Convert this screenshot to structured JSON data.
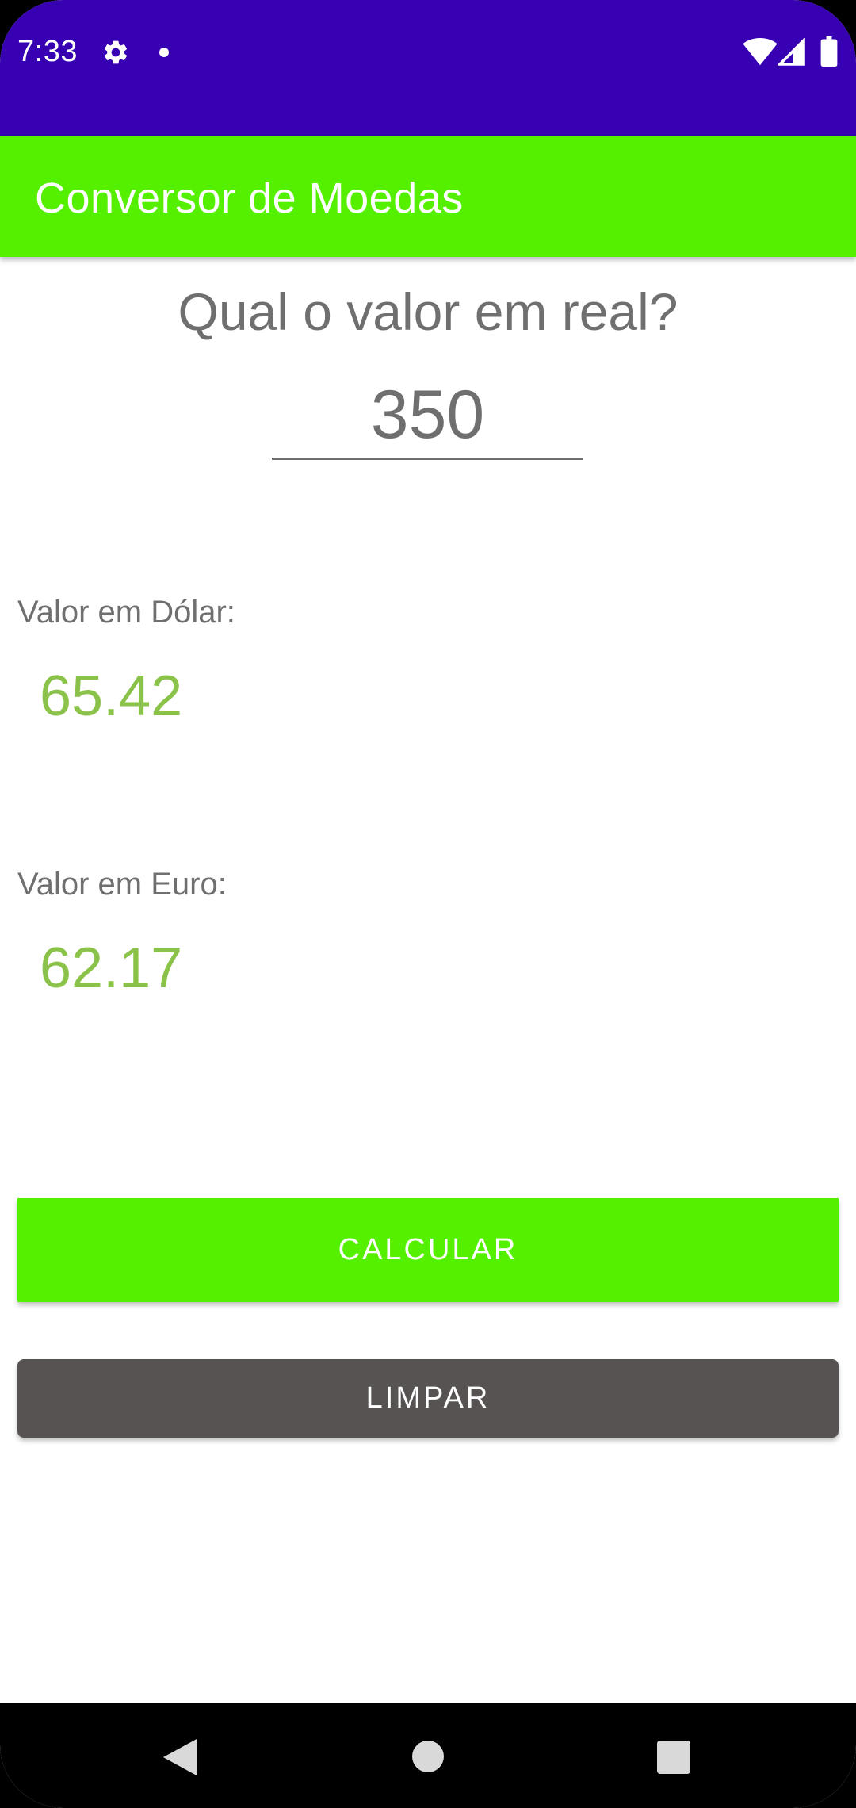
{
  "status_bar": {
    "time": "7:33",
    "icons": [
      "gear-icon",
      "notification-dot-icon",
      "wifi-icon",
      "signal-icon",
      "battery-icon"
    ],
    "background": "#3700b3"
  },
  "app_bar": {
    "title": "Conversor de Moedas",
    "background": "#55f000"
  },
  "main": {
    "question": "Qual o valor em real?",
    "input_value": "350",
    "dollar_label": "Valor em Dólar:",
    "dollar_value": "65.42",
    "euro_label": "Valor em Euro:",
    "euro_value": "62.17",
    "result_color": "#8bc34a"
  },
  "buttons": {
    "calculate_label": "CALCULAR",
    "clear_label": "LIMPAR",
    "calculate_color": "#55f000",
    "clear_color": "#575352"
  },
  "nav_bar": {
    "icons": [
      "back-icon",
      "home-icon",
      "recents-icon"
    ]
  }
}
